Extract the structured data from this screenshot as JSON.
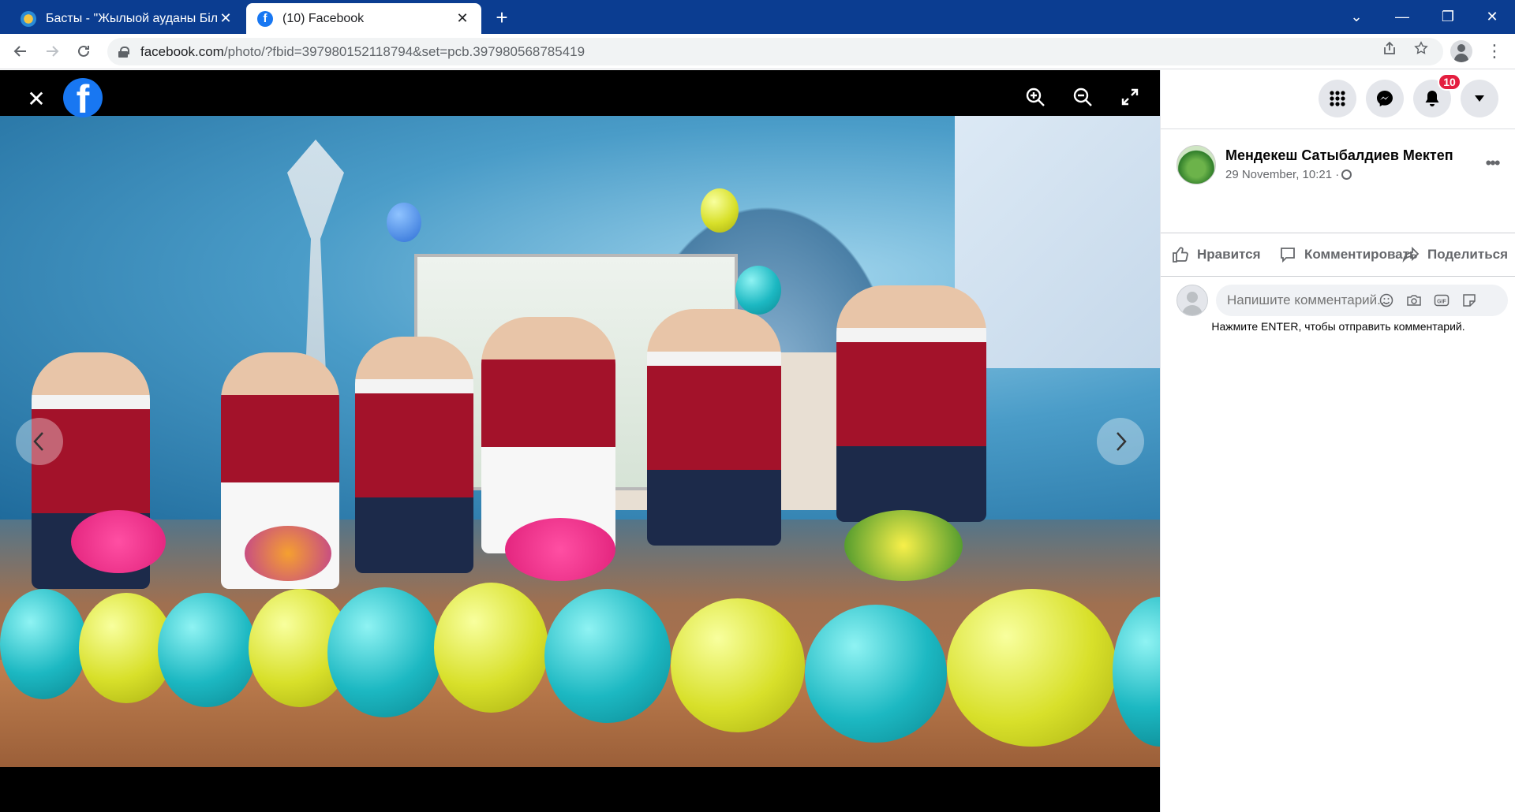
{
  "browser": {
    "tabs": [
      {
        "title": "Басты - \"Жылыой ауданы Білім",
        "close": "✕"
      },
      {
        "title": "(10) Facebook",
        "close": "✕"
      }
    ],
    "new_tab": "+",
    "window_controls": {
      "dropdown": "⌄",
      "minimize": "—",
      "restore": "❐",
      "close": "✕"
    },
    "url_host": "facebook.com",
    "url_rest": "/photo/?fbid=397980152118794&set=pcb.397980568785419"
  },
  "viewer": {
    "close": "✕",
    "logo": "f",
    "prev": "‹",
    "next": "›"
  },
  "panel": {
    "notifications_count": "10",
    "page_name": "Мендекеш Сатыбалдиев Мектеп",
    "post_date": "29 November, 10:21 ·",
    "more": "•••",
    "actions": {
      "like": "Нравится",
      "comment": "Комментировать",
      "share": "Поделиться"
    },
    "comment_placeholder": "Напишите комментарий...",
    "comment_hint": "Нажмите ENTER, чтобы отправить комментарий."
  },
  "colors": {
    "tabbar": "#0b3d91",
    "facebook_blue": "#1877f2",
    "badge_red": "#e41e3f",
    "balloon_teal": "#1cb8c2",
    "balloon_yellow": "#d8e02a"
  }
}
